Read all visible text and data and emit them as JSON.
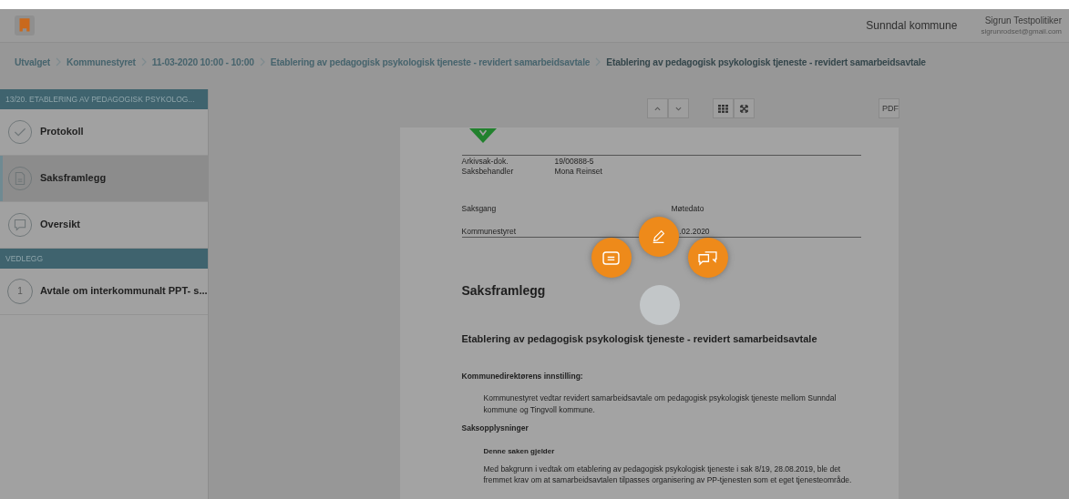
{
  "header": {
    "organization": "Sunndal kommune",
    "user": {
      "name": "Sigrun Testpolitiker",
      "email": "sigrunrodset@gmail.com"
    }
  },
  "breadcrumb": [
    {
      "label": "Utvalget",
      "current": false
    },
    {
      "label": "Kommunestyret",
      "current": false
    },
    {
      "label": "11-03-2020 10:00 - 10:00",
      "current": false
    },
    {
      "label": "Etablering av pedagogisk psykologisk tjeneste - revidert samarbeidsavtale",
      "current": false
    },
    {
      "label": "Etablering av pedagogisk psykologisk tjeneste - revidert samarbeidsavtale",
      "current": true
    }
  ],
  "sidebar": {
    "heading": "13/20. ETABLERING AV PEDAGOGISK PSYKOLOG...",
    "items": [
      {
        "kind": "check",
        "label": "Protokoll",
        "selected": false
      },
      {
        "kind": "document",
        "label": "Saksframlegg",
        "selected": true
      },
      {
        "kind": "chat",
        "label": "Oversikt",
        "selected": false
      }
    ],
    "attachments_heading": "VEDLEGG",
    "attachments": [
      {
        "number": "1",
        "label": "Avtale om interkommunalt PPT- s...",
        "selected": false
      }
    ]
  },
  "toolbar": {
    "pdf_button": "PDF"
  },
  "document": {
    "meta": [
      {
        "label": "Arkivsak-dok.",
        "value": "19/00888-5"
      },
      {
        "label": "Saksbehandler",
        "value": "Mona Reinset"
      }
    ],
    "saksgang_label": "Saksgang",
    "motedato_label": "Møtedato",
    "committee": "Kommunestyret",
    "date": ".02.2020",
    "title": "Saksframlegg",
    "subject": "Etablering av pedagogisk psykologisk tjeneste - revidert samarbeidsavtale",
    "recommendation_heading": "Kommunedirektørens innstilling:",
    "recommendation": "Kommunestyret vedtar revidert samarbeidsavtale om pedagogisk psykologisk tjeneste mellom Sunndal kommune og Tingvoll kommune.",
    "info_heading": "Saksopplysninger",
    "sub_heading": "Denne saken gjelder",
    "body": "Med bakgrunn i vedtak om etablering av pedagogisk psykologisk tjeneste i sak 8/19, 28.08.2019, ble det fremmet krav om at samarbeidsavtalen tilpasses organisering av PP-tjenesten som et eget tjenesteområde."
  },
  "action_menu": [
    {
      "kind": "note"
    },
    {
      "kind": "pen"
    },
    {
      "kind": "comments"
    }
  ]
}
